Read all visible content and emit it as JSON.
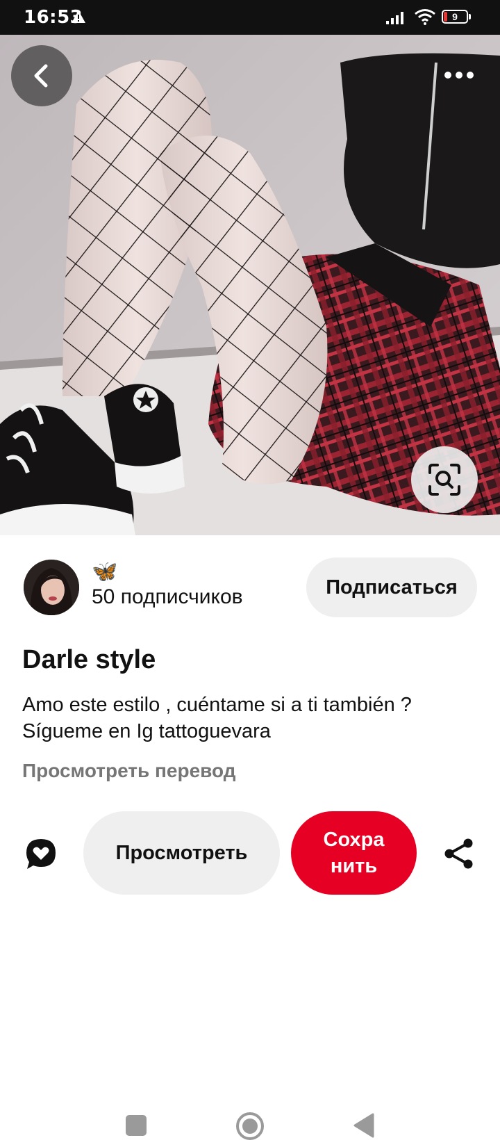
{
  "status_bar": {
    "time": "16:53",
    "battery_level": "9",
    "icons": [
      "warning-icon",
      "signal-icon",
      "wifi-icon",
      "battery-icon"
    ]
  },
  "pin": {
    "image": "fishnet-tights-plaid-skirt-photo",
    "title": "Darle style",
    "description_lines": [
      "Amo este estilo , cuéntame si a ti también ?",
      "Sígueme en Ig tattoguevara"
    ],
    "translate_label": "Просмотреть перевод"
  },
  "creator": {
    "name_emoji": "🦋",
    "followers_label": "50 подписчиков",
    "subscribe_label": "Подписаться"
  },
  "actions": {
    "view_label": "Просмотреть",
    "save_label_lines": [
      "Сохра",
      "нить"
    ]
  },
  "colors": {
    "save_button": "#e60023",
    "secondary_button": "#efefef",
    "link_gray": "#767676",
    "status_bar": "#111111"
  }
}
